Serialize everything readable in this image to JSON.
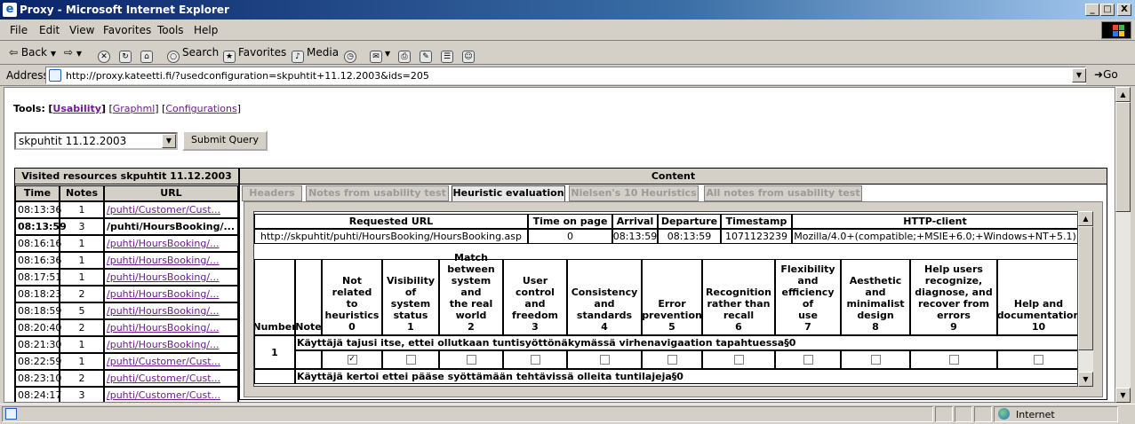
{
  "window": {
    "title": "Proxy - Microsoft Internet Explorer",
    "min": "_",
    "max": "□",
    "close": "X"
  },
  "menu": [
    "File",
    "Edit",
    "View",
    "Favorites",
    "Tools",
    "Help"
  ],
  "toolbar": {
    "back": "Back",
    "search": "Search",
    "favorites": "Favorites",
    "media": "Media"
  },
  "address": {
    "label": "Address",
    "url": "http://proxy.kateetti.fi/?usedconfiguration=skpuhtit+11.12.2003&ids=205",
    "go": "Go"
  },
  "status": {
    "zone": "Internet"
  },
  "tools": {
    "label": "Tools:",
    "items": [
      "Usability",
      "Graphml",
      "Configurations"
    ]
  },
  "form": {
    "select_value": "skpuhtit 11.12.2003",
    "submit": "Submit Query"
  },
  "left": {
    "title": "Visited resources skpuhtit 11.12.2003",
    "columns": [
      "Time",
      "Notes",
      "URL"
    ],
    "rows": [
      {
        "time": "08:13:36",
        "notes": "1",
        "url": "/puhti/Customer/Cust..."
      },
      {
        "time": "08:13:59",
        "notes": "3",
        "url": "/puhti/HoursBooking/..."
      },
      {
        "time": "08:16:16",
        "notes": "1",
        "url": "/puhti/HoursBooking/..."
      },
      {
        "time": "08:16:36",
        "notes": "1",
        "url": "/puhti/HoursBooking/..."
      },
      {
        "time": "08:17:51",
        "notes": "1",
        "url": "/puhti/HoursBooking/..."
      },
      {
        "time": "08:18:23",
        "notes": "2",
        "url": "/puhti/HoursBooking/..."
      },
      {
        "time": "08:18:59",
        "notes": "5",
        "url": "/puhti/HoursBooking/..."
      },
      {
        "time": "08:20:40",
        "notes": "2",
        "url": "/puhti/HoursBooking/..."
      },
      {
        "time": "08:21:30",
        "notes": "1",
        "url": "/puhti/HoursBooking/..."
      },
      {
        "time": "08:22:59",
        "notes": "1",
        "url": "/puhti/Customer/Cust..."
      },
      {
        "time": "08:23:10",
        "notes": "2",
        "url": "/puhti/Customer/Cust..."
      },
      {
        "time": "08:24:17",
        "notes": "3",
        "url": "/puhti/Customer/Cust..."
      }
    ]
  },
  "content": {
    "title": "Content",
    "tabs": [
      "Headers",
      "Notes from usability test",
      "Heuristic evaluation",
      "Nielsen's 10 Heuristics",
      "All notes from usability test"
    ],
    "request": {
      "headers": [
        "Requested URL",
        "Time on page",
        "Arrival",
        "Departure",
        "Timestamp",
        "HTTP-client"
      ],
      "values": [
        "http://skpuhtit/puhti/HoursBooking/HoursBooking.asp",
        "0",
        "08:13:59",
        "08:13:59",
        "1071123239",
        "Mozilla/4.0+(compatible;+MSIE+6.0;+Windows+NT+5.1)"
      ]
    },
    "heuristics": {
      "number_label": "Number",
      "note_label": "Note",
      "columns": [
        {
          "l1": "Not related",
          "l2": "to",
          "l3": "heuristics",
          "n": "0"
        },
        {
          "l1": "Visibility of",
          "l2": "system",
          "l3": "status",
          "n": "1"
        },
        {
          "l1": "Match",
          "l2": "between",
          "l3": "system and",
          "l4": "the real",
          "l5": "world",
          "n": "2"
        },
        {
          "l1": "User",
          "l2": "control and",
          "l3": "freedom",
          "n": "3"
        },
        {
          "l1": "Consistency",
          "l2": "and standards",
          "n": "4"
        },
        {
          "l1": "Error",
          "l2": "prevention",
          "n": "5"
        },
        {
          "l1": "Recognition",
          "l2": "rather than",
          "l3": "recall",
          "n": "6"
        },
        {
          "l1": "Flexibility",
          "l2": "and",
          "l3": "efficiency of",
          "l4": "use",
          "n": "7"
        },
        {
          "l1": "Aesthetic",
          "l2": "and",
          "l3": "minimalist",
          "l4": "design",
          "n": "8"
        },
        {
          "l1": "Help users",
          "l2": "recognize,",
          "l3": "diagnose, and",
          "l4": "recover from",
          "l5": "errors",
          "n": "9"
        },
        {
          "l1": "Help and",
          "l2": "documentation",
          "n": "10"
        }
      ],
      "rows": [
        {
          "number": "1",
          "note": "Käyttäjä tajusi itse, ettei ollutkaan tuntisyöttönäkymässä virhenavigaation tapahtuessa§0",
          "checked": 0
        },
        {
          "number": "",
          "note": "Käyttäjä kertoi ettei pääse syöttämään tehtävissä olleita tuntilajeja§0",
          "checked": -1
        }
      ]
    }
  }
}
